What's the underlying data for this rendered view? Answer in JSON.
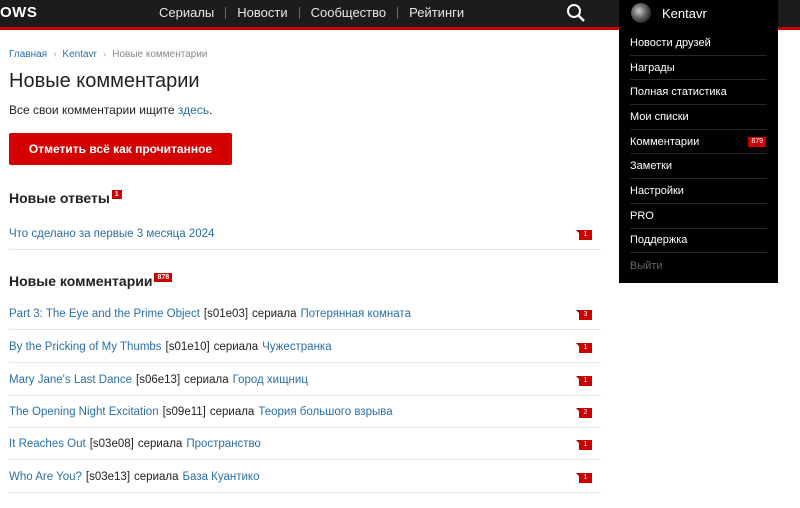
{
  "header": {
    "logo": "OWS",
    "nav": [
      "Сериалы",
      "Новости",
      "Сообщество",
      "Рейтинги"
    ],
    "search_icon": "search-icon"
  },
  "user_menu": {
    "username": "Kentavr",
    "items": [
      {
        "label": "Новости друзей"
      },
      {
        "label": "Награды"
      },
      {
        "label": "Полная статистика"
      },
      {
        "label": "Мои списки"
      },
      {
        "label": "Комментарии",
        "badge": "879"
      },
      {
        "label": "Заметки"
      },
      {
        "label": "Настройки"
      },
      {
        "label": "PRO"
      },
      {
        "label": "Поддержка"
      },
      {
        "label": "Выйти"
      }
    ]
  },
  "breadcrumb": {
    "home": "Главная",
    "user": "Kentavr",
    "current": "Новые комментарии"
  },
  "page": {
    "title": "Новые комментарии",
    "hint_text": "Все свои комментарии ищите ",
    "hint_link": "здесь",
    "hint_end": ".",
    "mark_all_button": "Отметить всё как прочитанное"
  },
  "replies": {
    "title": "Новые ответы",
    "badge": "1",
    "items": [
      {
        "text": "Что сделано за первые 3 месяца 2024",
        "count": "1"
      }
    ]
  },
  "comments": {
    "title": "Новые комментарии",
    "badge": "878",
    "series_word": "сериала",
    "items": [
      {
        "episode": "Part 3: The Eye and the Prime Object",
        "code": "[s01e03]",
        "show": "Потерянная комната",
        "count": "3"
      },
      {
        "episode": "By the Pricking of My Thumbs",
        "code": "[s01e10]",
        "show": "Чужестранка",
        "count": "1"
      },
      {
        "episode": "Mary Jane's Last Dance",
        "code": "[s06e13]",
        "show": "Город хищниц",
        "count": "1"
      },
      {
        "episode": "The Opening Night Excitation",
        "code": "[s09e11]",
        "show": "Теория большого взрыва",
        "count": "2"
      },
      {
        "episode": "It Reaches Out",
        "code": "[s03e08]",
        "show": "Пространство",
        "count": "1"
      },
      {
        "episode": "Who Are You?",
        "code": "[s03e13]",
        "show": "База Куантико",
        "count": "1"
      }
    ]
  },
  "colors": {
    "accent": "#d40000",
    "link": "#2a6fa8",
    "header_bg": "#1c1c1c"
  }
}
